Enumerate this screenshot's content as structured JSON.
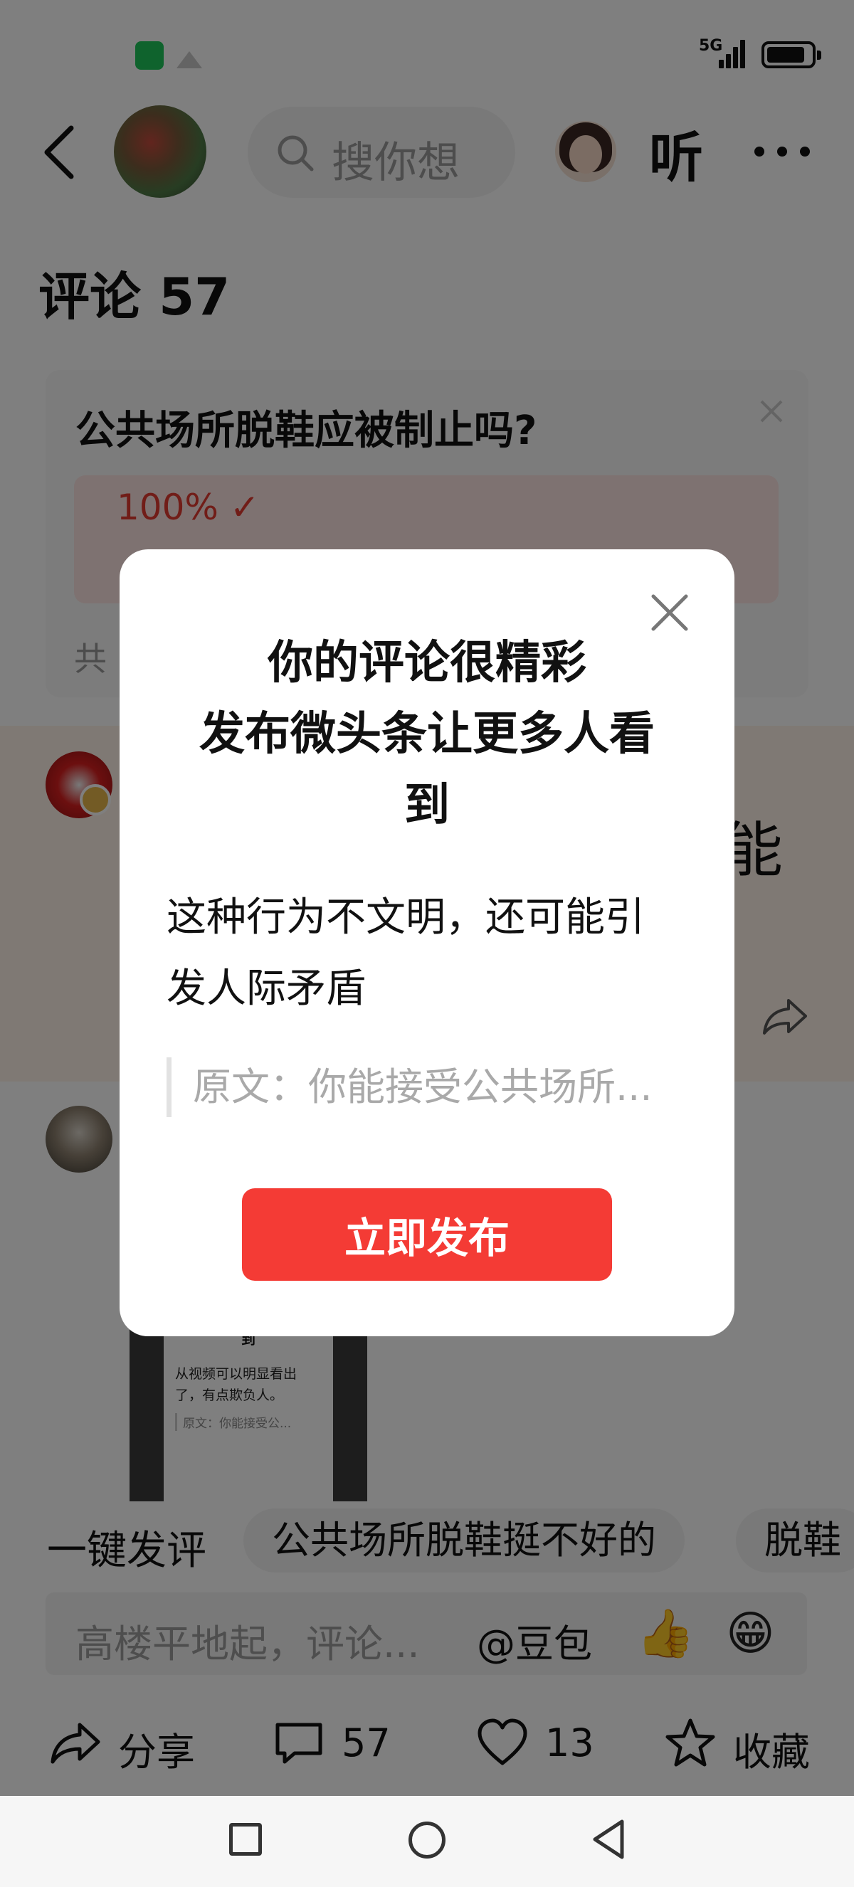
{
  "status_bar": {
    "network": "5G"
  },
  "header": {
    "search_placeholder": "搜你想",
    "listen_label": "听"
  },
  "comments": {
    "title": "评论 57"
  },
  "poll": {
    "question": "公共场所脱鞋应被制止吗?",
    "percent_text": "100% ✓",
    "footer_text": "共"
  },
  "comment_1": {
    "text_tail": "能"
  },
  "thumbnail": {
    "title": "发布微头条让更多人看到",
    "body": "从视频可以明显看出了，有点欺负人。",
    "quote": "原文：你能接受公..."
  },
  "suggestions": {
    "label": "一键发评",
    "chips": [
      "公共场所脱鞋挺不好的",
      "脱鞋"
    ]
  },
  "comment_box": {
    "placeholder": "高楼平地起，评论...",
    "mention": "@豆包",
    "emoji_thumbs": "👍",
    "emoji_grin": "😁"
  },
  "actions": {
    "share": "分享",
    "comment_count": "57",
    "like_count": "13",
    "collect": "收藏"
  },
  "modal": {
    "title_line1": "你的评论很精彩",
    "title_line2": "发布微头条让更多人看",
    "title_line3": "到",
    "body_line1": "这种行为不文明，还可能引",
    "body_line2": "发人际矛盾",
    "quote": "原文：你能接受公共场所...",
    "publish_button": "立即发布"
  },
  "colors": {
    "accent_red": "#f43b35",
    "overlay": "rgba(0,0,0,0.5)"
  }
}
